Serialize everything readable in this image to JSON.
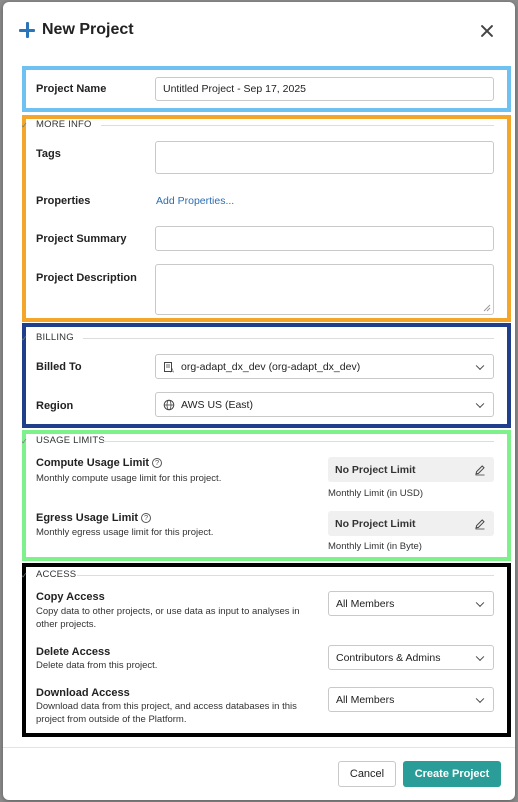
{
  "dialog": {
    "title": "New Project",
    "cancel_label": "Cancel",
    "create_label": "Create Project"
  },
  "project_name": {
    "label": "Project Name",
    "value": "Untitled Project - Sep 17, 2025"
  },
  "more_info": {
    "heading": "MORE INFO",
    "tags_label": "Tags",
    "tags_value": "",
    "properties_label": "Properties",
    "properties_link": "Add Properties...",
    "summary_label": "Project Summary",
    "summary_value": "",
    "description_label": "Project Description",
    "description_value": ""
  },
  "billing": {
    "heading": "BILLING",
    "billed_to_label": "Billed To",
    "billed_to_value": "org-adapt_dx_dev (org-adapt_dx_dev)",
    "billed_to_icon": "org-icon",
    "region_label": "Region",
    "region_value": "AWS US (East)",
    "region_icon": "globe-icon"
  },
  "usage_limits": {
    "heading": "USAGE LIMITS",
    "compute": {
      "label": "Compute Usage Limit",
      "description": "Monthly compute usage limit for this project.",
      "value": "No Project Limit",
      "unit_label": "Monthly Limit (in USD)"
    },
    "egress": {
      "label": "Egress Usage Limit",
      "description": "Monthly egress usage limit for this project.",
      "value": "No Project Limit",
      "unit_label": "Monthly Limit (in Byte)"
    }
  },
  "access": {
    "heading": "ACCESS",
    "copy": {
      "label": "Copy Access",
      "description": "Copy data to other projects, or use data as input to analyses in other projects.",
      "value": "All Members"
    },
    "delete": {
      "label": "Delete Access",
      "description": "Delete data from this project.",
      "value": "Contributors & Admins"
    },
    "download": {
      "label": "Download Access",
      "description": "Download data from this project, and access databases in this project from outside of the Platform.",
      "value": "All Members"
    }
  },
  "colors": {
    "accent": "#2b74b8",
    "primary_button": "#2a9d98",
    "highlight_blue": "#6ec1f1",
    "highlight_orange": "#f3a62a",
    "highlight_navy": "#1f3f8c",
    "highlight_green": "#7ef08c",
    "highlight_black": "#000000"
  }
}
